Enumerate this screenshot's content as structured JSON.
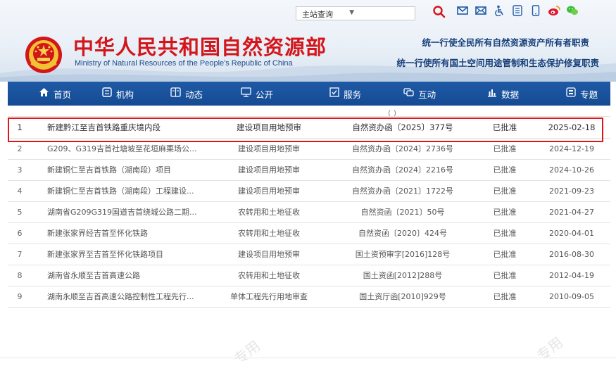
{
  "top_bar": {
    "search_select_label": "主站查询",
    "icons": [
      "search-icon",
      "email-icon",
      "email-alt-icon",
      "accessibility-icon",
      "app-icon",
      "mobile-icon",
      "weibo-icon",
      "wechat-icon"
    ]
  },
  "header": {
    "title_cn": "中华人民共和国自然资源部",
    "title_en": "Ministry of Natural Resources of the People's Republic of China",
    "slogan_line1": "统一行使全民所有自然资源资产所有者职责",
    "slogan_line2": "统一行使所有国土空间用途管制和生态保护修复职责"
  },
  "nav": {
    "items": [
      {
        "label": "首页",
        "icon": "home-icon"
      },
      {
        "label": "机构",
        "icon": "institution-icon"
      },
      {
        "label": "动态",
        "icon": "news-icon"
      },
      {
        "label": "公开",
        "icon": "disclosure-icon"
      },
      {
        "label": "服务",
        "icon": "service-icon"
      },
      {
        "label": "互动",
        "icon": "interaction-icon"
      },
      {
        "label": "数据",
        "icon": "data-icon"
      },
      {
        "label": "专题",
        "icon": "topic-icon"
      }
    ]
  },
  "table": {
    "cut_row_text": "( )",
    "rows": [
      {
        "no": "1",
        "name": "新建黔江至吉首铁路重庆境内段",
        "type": "建设项目用地预审",
        "doc": "自然资办函〔2025〕377号",
        "status": "已批准",
        "date": "2025-02-18"
      },
      {
        "no": "2",
        "name": "G209、G319吉首社塘坡至花垣麻栗场公...",
        "type": "建设项目用地预审",
        "doc": "自然资办函〔2024〕2736号",
        "status": "已批准",
        "date": "2024-12-19"
      },
      {
        "no": "3",
        "name": "新建铜仁至吉首铁路（湖南段）项目",
        "type": "建设项目用地预审",
        "doc": "自然资办函〔2024〕2216号",
        "status": "已批准",
        "date": "2024-10-26"
      },
      {
        "no": "4",
        "name": "新建铜仁至吉首铁路（湖南段）工程建设...",
        "type": "建设项目用地预审",
        "doc": "自然资办函〔2021〕1722号",
        "status": "已批准",
        "date": "2021-09-23"
      },
      {
        "no": "5",
        "name": "湖南省G209G319国道吉首绕城公路二期...",
        "type": "农转用和土地征收",
        "doc": "自然资函〔2021〕50号",
        "status": "已批准",
        "date": "2021-04-27"
      },
      {
        "no": "6",
        "name": "新建张家界经吉首至怀化铁路",
        "type": "农转用和土地征收",
        "doc": "自然资函〔2020〕424号",
        "status": "已批准",
        "date": "2020-04-01"
      },
      {
        "no": "7",
        "name": "新建张家界至吉首至怀化铁路项目",
        "type": "建设项目用地预审",
        "doc": "国土资预审字[2016]128号",
        "status": "已批准",
        "date": "2016-08-30"
      },
      {
        "no": "8",
        "name": "湖南省永顺至吉首高速公路",
        "type": "农转用和土地征收",
        "doc": "国土资函[2012]288号",
        "status": "已批准",
        "date": "2012-04-19"
      },
      {
        "no": "9",
        "name": "湖南永顺至吉首高速公路控制性工程先行...",
        "type": "单体工程先行用地审查",
        "doc": "国土资厅函[2010]929号",
        "status": "已批准",
        "date": "2010-09-05"
      }
    ]
  },
  "watermark_text": "专用",
  "colors": {
    "brand_red": "#d3161c",
    "nav_blue": "#1a52a0",
    "highlight_red": "#e0161b",
    "slogan_blue": "#163f7a"
  }
}
